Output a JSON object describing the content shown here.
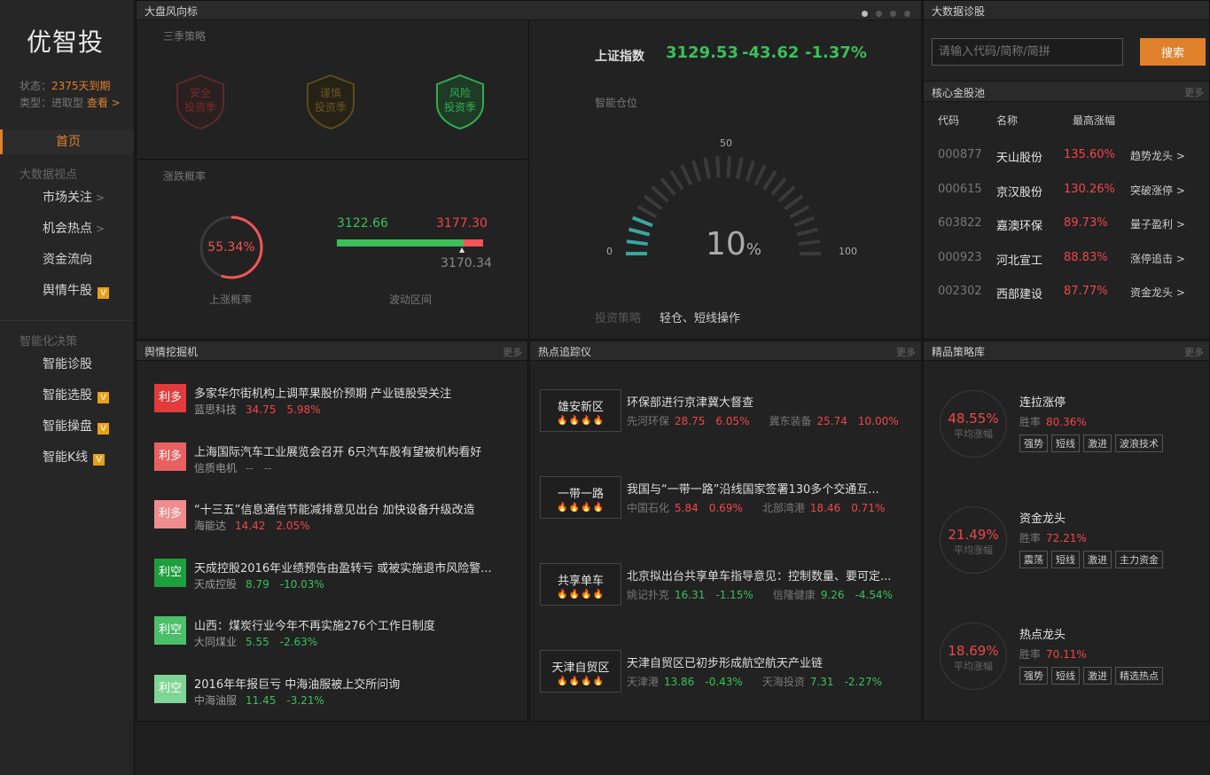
{
  "sidebar": {
    "logo": "优智投",
    "status_label": "状态：",
    "status_value": "2375天到期",
    "type_label": "类型：进取型",
    "view_link": "查看 >",
    "home": "首页",
    "group1": "大数据视点",
    "items1": [
      {
        "label": "市场关注",
        "chev": ">"
      },
      {
        "label": "机会热点",
        "chev": ">"
      },
      {
        "label": "资金流向",
        "chev": ""
      },
      {
        "label": "舆情牛股",
        "badge": "V"
      }
    ],
    "group2": "智能化决策",
    "items2": [
      {
        "label": "智能诊股",
        "badge": ""
      },
      {
        "label": "智能选股",
        "badge": "V"
      },
      {
        "label": "智能操盘",
        "badge": "V"
      },
      {
        "label": "智能K线",
        "badge": "V"
      }
    ]
  },
  "market": {
    "title": "大盘风向标",
    "season_label": "三季策略",
    "seasons": [
      {
        "line1": "安全",
        "line2": "投资季",
        "color": "#7a2a2a"
      },
      {
        "line1": "谨慎",
        "line2": "投资季",
        "color": "#6a5520"
      },
      {
        "line1": "风险",
        "line2": "投资季",
        "color": "#2fae4e"
      }
    ],
    "updown_label": "涨跌概率",
    "rise_prob": "55.34%",
    "rise_prob_value": 55.34,
    "rise_label": "上涨概率",
    "range_low": "3122.66",
    "range_high": "3177.30",
    "range_current": "3170.34",
    "range_label": "波动区间",
    "index_name": "上证指数",
    "index_value": "3129.53",
    "index_change": "-43.62",
    "index_pct": "-1.37%",
    "position_label": "智能仓位",
    "gauge_min": "0",
    "gauge_mid": "50",
    "gauge_max": "100",
    "gauge_value": "10",
    "gauge_unit": "%",
    "gauge_percent": 10,
    "strategy_label": "投资策略",
    "strategy_value": "轻仓、短线操作"
  },
  "diag": {
    "title": "大数据诊股",
    "placeholder": "请输入代码/简称/简拼",
    "search_btn": "搜索"
  },
  "pool": {
    "title": "核心金股池",
    "more": "更多",
    "headers": [
      "代码",
      "名称",
      "最高涨幅"
    ],
    "rows": [
      {
        "code": "000877",
        "name": "天山股份",
        "pct": "135.60%",
        "tag": "趋势龙头 >"
      },
      {
        "code": "000615",
        "name": "京汉股份",
        "pct": "130.26%",
        "tag": "突破涨停 >"
      },
      {
        "code": "603822",
        "name": "嘉澳环保",
        "pct": "89.73%",
        "tag": "量子盈利 >"
      },
      {
        "code": "000923",
        "name": "河北宣工",
        "pct": "88.83%",
        "tag": "涨停追击 >"
      },
      {
        "code": "002302",
        "name": "西部建设",
        "pct": "87.77%",
        "tag": "资金龙头 >"
      }
    ]
  },
  "sentiment": {
    "title": "舆情挖掘机",
    "more": "更多",
    "items": [
      {
        "badge": "利多",
        "color": "#e23b3b",
        "title": "多家华尔街机构上调苹果股价预期 产业链股受关注",
        "stock": "蓝思科技",
        "price": "34.75",
        "pct": "5.98%",
        "dir": "up"
      },
      {
        "badge": "利多",
        "color": "#e86060",
        "title": "上海国际汽车工业展览会召开 6只汽车股有望被机构看好",
        "stock": "信质电机",
        "price": "--",
        "pct": "--",
        "dir": "none"
      },
      {
        "badge": "利多",
        "color": "#f08c8c",
        "title": "“十三五”信息通信节能减排意见出台 加快设备升级改造",
        "stock": "海能达",
        "price": "14.42",
        "pct": "2.05%",
        "dir": "up"
      },
      {
        "badge": "利空",
        "color": "#1f9e3e",
        "title": "天成控股2016年业绩预告由盈转亏 或被实施退市风险警...",
        "stock": "天成控股",
        "price": "8.79",
        "pct": "-10.03%",
        "dir": "down"
      },
      {
        "badge": "利空",
        "color": "#4cbf6a",
        "title": "山西：煤炭行业今年不再实施276个工作日制度",
        "stock": "大同煤业",
        "price": "5.55",
        "pct": "-2.63%",
        "dir": "down"
      },
      {
        "badge": "利空",
        "color": "#7fd595",
        "title": "2016年年报巨亏 中海油服被上交所问询",
        "stock": "中海油服",
        "price": "11.45",
        "pct": "-3.21%",
        "dir": "down"
      }
    ]
  },
  "hot": {
    "title": "热点追踪仪",
    "more": "更多",
    "items": [
      {
        "name": "雄安新区",
        "fire": "🔥🔥🔥🔥",
        "title": "环保部进行京津冀大督查",
        "s1": "先河环保",
        "p1": "28.75",
        "c1": "6.05%",
        "s2": "冀东装备",
        "p2": "25.74",
        "c2": "10.00%",
        "d1": "up",
        "d2": "up"
      },
      {
        "name": "一带一路",
        "fire": "🔥🔥🔥🔥",
        "title": "我国与“一带一路”沿线国家签署130多个交通互...",
        "s1": "中国石化",
        "p1": "5.84",
        "c1": "0.69%",
        "s2": "北部湾港",
        "p2": "18.46",
        "c2": "0.71%",
        "d1": "up",
        "d2": "up"
      },
      {
        "name": "共享单车",
        "fire": "🔥🔥🔥🔥",
        "title": "北京拟出台共享单车指导意见：控制数量、要可定...",
        "s1": "姚记扑克",
        "p1": "16.31",
        "c1": "-1.15%",
        "s2": "信隆健康",
        "p2": "9.26",
        "c2": "-4.54%",
        "d1": "down",
        "d2": "down"
      },
      {
        "name": "天津自贸区",
        "fire": "🔥🔥🔥🔥",
        "title": "天津自贸区已初步形成航空航天产业链",
        "s1": "天津港",
        "p1": "13.86",
        "c1": "-0.43%",
        "s2": "天海投资",
        "p2": "7.31",
        "c2": "-2.27%",
        "d1": "down",
        "d2": "down"
      }
    ]
  },
  "strat": {
    "title": "精品策略库",
    "more": "更多",
    "avg_label": "平均涨幅",
    "win_label": "胜率",
    "items": [
      {
        "pct": "48.55%",
        "name": "连拉涨停",
        "win": "80.36%",
        "tags": [
          "强势",
          "短线",
          "激进",
          "波浪技术"
        ]
      },
      {
        "pct": "21.49%",
        "name": "资金龙头",
        "win": "72.21%",
        "tags": [
          "震荡",
          "短线",
          "激进",
          "主力资金"
        ]
      },
      {
        "pct": "18.69%",
        "name": "热点龙头",
        "win": "70.11%",
        "tags": [
          "强势",
          "短线",
          "激进",
          "精选热点"
        ]
      }
    ]
  }
}
